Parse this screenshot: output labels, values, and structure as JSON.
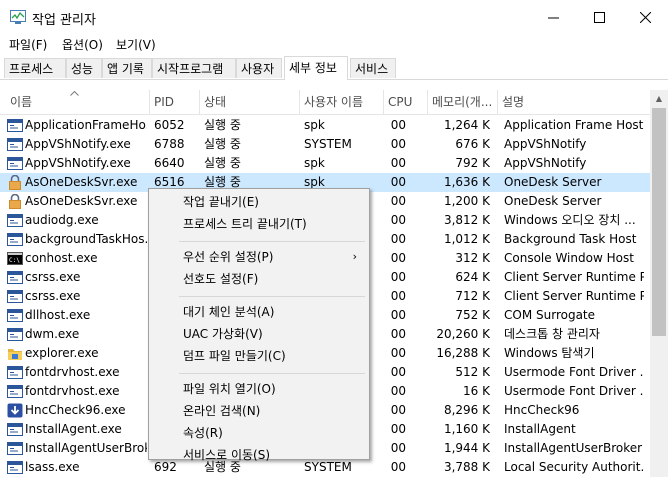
{
  "window": {
    "title": "작업 관리자"
  },
  "menu": [
    "파일(F)",
    "옵션(O)",
    "보기(V)"
  ],
  "tabs": [
    {
      "label": "프로세스",
      "active": false
    },
    {
      "label": "성능",
      "active": false
    },
    {
      "label": "앱 기록",
      "active": false
    },
    {
      "label": "시작프로그램",
      "active": false
    },
    {
      "label": "사용자",
      "active": false
    },
    {
      "label": "세부 정보",
      "active": true
    },
    {
      "label": "서비스",
      "active": false
    }
  ],
  "columns": [
    "이름",
    "PID",
    "상태",
    "사용자 이름",
    "CPU",
    "메모리(개...",
    "설명"
  ],
  "rows": [
    {
      "icon": "app-window-icon",
      "name": "ApplicationFrameHo...",
      "pid": "6052",
      "status": "실행 중",
      "user": "spk",
      "cpu": "00",
      "mem": "1,264 K",
      "desc": "Application Frame Host",
      "selected": false
    },
    {
      "icon": "app-window-icon",
      "name": "AppVShNotify.exe",
      "pid": "6788",
      "status": "실행 중",
      "user": "SYSTEM",
      "cpu": "00",
      "mem": "676 K",
      "desc": "AppVShNotify",
      "selected": false
    },
    {
      "icon": "app-window-icon",
      "name": "AppVShNotify.exe",
      "pid": "6640",
      "status": "실행 중",
      "user": "spk",
      "cpu": "00",
      "mem": "792 K",
      "desc": "AppVShNotify",
      "selected": false
    },
    {
      "icon": "lock-icon",
      "name": "AsOneDeskSvr.exe",
      "pid": "6516",
      "status": "실행 중",
      "user": "spk",
      "cpu": "00",
      "mem": "1,636 K",
      "desc": "OneDesk Server",
      "selected": true
    },
    {
      "icon": "lock-icon",
      "name": "AsOneDeskSvr.exe",
      "pid": "",
      "status": "",
      "user": "",
      "cpu": "00",
      "mem": "1,200 K",
      "desc": "OneDesk Server",
      "selected": false
    },
    {
      "icon": "app-window-icon",
      "name": "audiodg.exe",
      "pid": "",
      "status": "",
      "user": "",
      "cpu": "00",
      "mem": "3,812 K",
      "desc": "Windows 오디오 장치 ...",
      "selected": false
    },
    {
      "icon": "app-window-icon",
      "name": "backgroundTaskHos...",
      "pid": "",
      "status": "",
      "user": "",
      "cpu": "00",
      "mem": "1,012 K",
      "desc": "Background Task Host",
      "selected": false
    },
    {
      "icon": "console-icon",
      "name": "conhost.exe",
      "pid": "",
      "status": "",
      "user": "",
      "cpu": "00",
      "mem": "312 K",
      "desc": "Console Window Host",
      "selected": false
    },
    {
      "icon": "app-window-icon",
      "name": "csrss.exe",
      "pid": "",
      "status": "",
      "user": "",
      "cpu": "00",
      "mem": "624 K",
      "desc": "Client Server Runtime P...",
      "selected": false
    },
    {
      "icon": "app-window-icon",
      "name": "csrss.exe",
      "pid": "",
      "status": "",
      "user": "",
      "cpu": "00",
      "mem": "712 K",
      "desc": "Client Server Runtime P...",
      "selected": false
    },
    {
      "icon": "app-window-icon",
      "name": "dllhost.exe",
      "pid": "",
      "status": "",
      "user": "",
      "cpu": "00",
      "mem": "752 K",
      "desc": "COM Surrogate",
      "selected": false
    },
    {
      "icon": "app-window-icon",
      "name": "dwm.exe",
      "pid": "",
      "status": "",
      "user": "",
      "cpu": "00",
      "mem": "20,260 K",
      "desc": "데스크톱 창 관리자",
      "selected": false
    },
    {
      "icon": "folder-icon",
      "name": "explorer.exe",
      "pid": "",
      "status": "",
      "user": "",
      "cpu": "00",
      "mem": "16,288 K",
      "desc": "Windows 탐색기",
      "selected": false
    },
    {
      "icon": "app-window-icon",
      "name": "fontdrvhost.exe",
      "pid": "",
      "status": "",
      "user": "",
      "cpu": "00",
      "mem": "512 K",
      "desc": "Usermode Font Driver ...",
      "selected": false
    },
    {
      "icon": "app-window-icon",
      "name": "fontdrvhost.exe",
      "pid": "",
      "status": "",
      "user": "",
      "cpu": "00",
      "mem": "16 K",
      "desc": "Usermode Font Driver ...",
      "selected": false
    },
    {
      "icon": "download-icon",
      "name": "HncCheck96.exe",
      "pid": "",
      "status": "",
      "user": "",
      "cpu": "00",
      "mem": "8,296 K",
      "desc": "HncCheck96",
      "selected": false
    },
    {
      "icon": "app-window-icon",
      "name": "InstallAgent.exe",
      "pid": "",
      "status": "",
      "user": "",
      "cpu": "00",
      "mem": "1,160 K",
      "desc": "InstallAgent",
      "selected": false
    },
    {
      "icon": "app-window-icon",
      "name": "InstallAgentUserBrok...",
      "pid": "",
      "status": "",
      "user": "",
      "cpu": "00",
      "mem": "1,944 K",
      "desc": "InstallAgentUserBroker",
      "selected": false
    },
    {
      "icon": "app-window-icon",
      "name": "lsass.exe",
      "pid": "692",
      "status": "실행 중",
      "user": "SYSTEM",
      "cpu": "00",
      "mem": "3,788 K",
      "desc": "Local Security Authorit...",
      "selected": false
    }
  ],
  "context_menu": [
    {
      "label": "작업 끝내기(E)",
      "submenu": false
    },
    {
      "label": "프로세스 트리 끝내기(T)",
      "submenu": false
    },
    {
      "separator": true
    },
    {
      "label": "우선 순위 설정(P)",
      "submenu": true
    },
    {
      "label": "선호도 설정(F)",
      "submenu": false
    },
    {
      "separator": true
    },
    {
      "label": "대기 체인 분석(A)",
      "submenu": false
    },
    {
      "label": "UAC 가상화(V)",
      "submenu": false
    },
    {
      "label": "덤프 파일 만들기(C)",
      "submenu": false
    },
    {
      "separator": true
    },
    {
      "label": "파일 위치 열기(O)",
      "submenu": false
    },
    {
      "label": "온라인 검색(N)",
      "submenu": false
    },
    {
      "label": "속성(R)",
      "submenu": false
    },
    {
      "label": "서비스로 이동(S)",
      "submenu": false
    }
  ],
  "colors": {
    "selection": "#cce8ff",
    "menu_bg": "#f2f2f2",
    "scroll_thumb": "#c2c2c2"
  }
}
